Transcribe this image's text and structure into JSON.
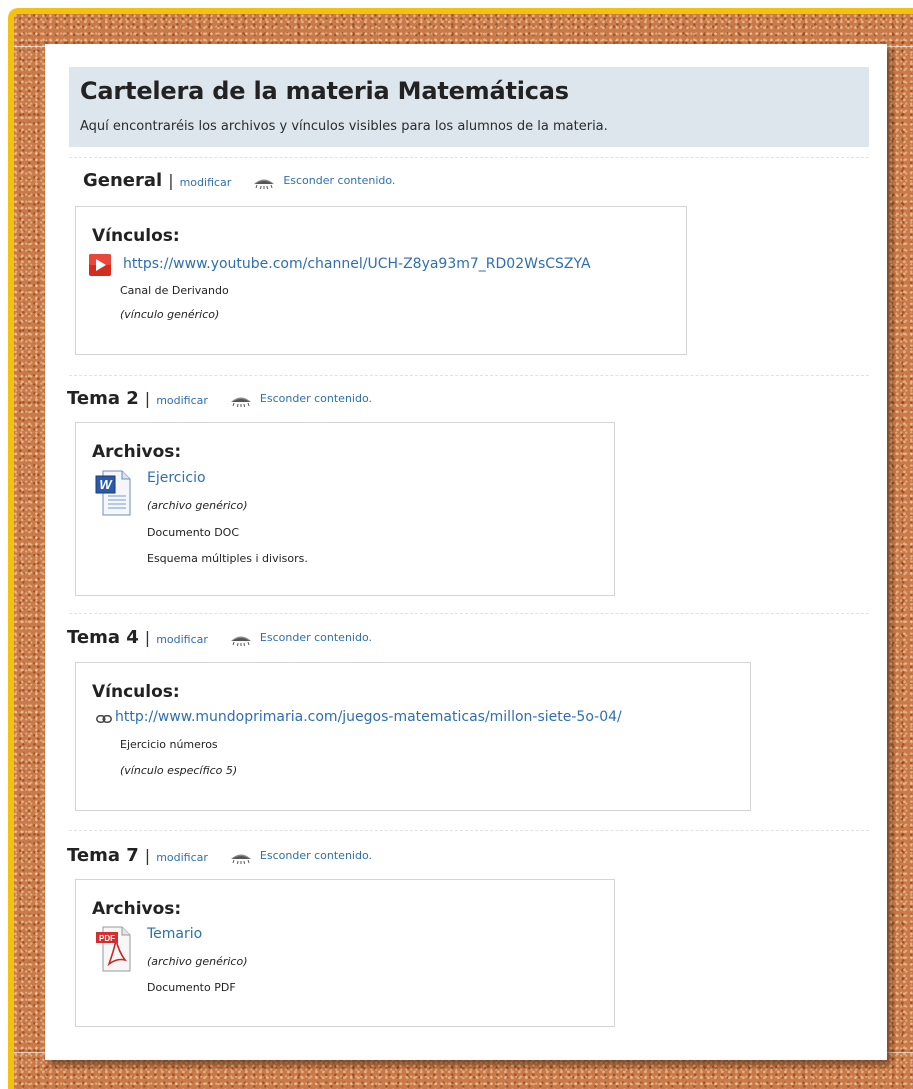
{
  "board": {
    "title": "Cartelera de la materia Matemáticas",
    "subtitle": "Aquí encontraréis los archivos y vínculos visibles para los alumnos de la materia."
  },
  "actions": {
    "modify_label": "modificar",
    "hide_label": "Esconder contenido.",
    "separator": "|"
  },
  "sections": [
    {
      "title": "General",
      "box_title": "Vínculos:",
      "item": {
        "icon": "youtube-play-icon",
        "link": "https://www.youtube.com/channel/UCH-Z8ya93m7_RD02WsCSZYA",
        "description": "Canal de Derivando",
        "type": "(vínculo genérico)"
      }
    },
    {
      "title": "Tema 2",
      "box_title": "Archivos:",
      "item": {
        "icon": "word-document-icon",
        "link": "Ejercicio",
        "type": "(archivo genérico)",
        "format": "Documento DOC",
        "description": "Esquema múltiples i divisors."
      }
    },
    {
      "title": "Tema 4",
      "box_title": "Vínculos:",
      "item": {
        "icon": "chain-link-icon",
        "link": "http://www.mundoprimaria.com/juegos-matematicas/millon-siete-5o-04/",
        "description": "Ejercicio números",
        "type": "(vínculo específico 5)"
      }
    },
    {
      "title": "Tema 7",
      "box_title": "Archivos:",
      "item": {
        "icon": "pdf-document-icon",
        "link": "Temario",
        "type": "(archivo genérico)",
        "format": "Documento PDF"
      }
    }
  ],
  "colors": {
    "frame": "#f4c20d",
    "cork": "#c97a48",
    "header_bg": "#dde6ed",
    "link": "#2d6fb0"
  }
}
